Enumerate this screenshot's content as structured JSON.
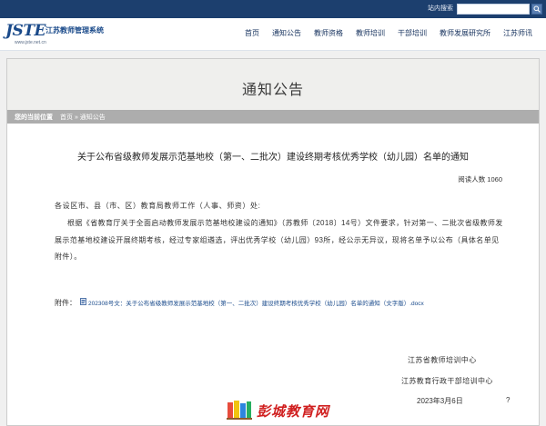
{
  "topbar": {
    "search_label": "站内搜索"
  },
  "logo": {
    "mark_main": "JSTE",
    "mark_accent": "",
    "name": "江苏教师管理系统",
    "url": "www.jste.net.cn"
  },
  "nav": [
    {
      "label": "首页"
    },
    {
      "label": "通知公告"
    },
    {
      "label": "教师资格"
    },
    {
      "label": "教师培训"
    },
    {
      "label": "干部培训"
    },
    {
      "label": "教师发展研究所"
    },
    {
      "label": "江苏师讯"
    }
  ],
  "banner": {
    "title": "通知公告"
  },
  "breadcrumb": {
    "head": "您的当前位置",
    "path": "首页 » 通知公告"
  },
  "article": {
    "title": "关于公布省级教师发展示范基地校（第一、二批次）建设终期考核优秀学校（幼儿园）名单的通知",
    "read_count": "阅读人数 1060",
    "salutation": "各设区市、县（市、区）教育局教师工作（人事、师资）处:",
    "body": "根据《省教育厅关于全面启动教师发展示范基地校建设的通知》（苏教师〔2018〕14号）文件要求，针对第一、二批次省级教师发展示范基地校建设开展终期考核，经过专家组遴选，评出优秀学校（幼儿园）93所，经公示无异议，现将名单予以公布（具体名单见附件）。",
    "attachment_label": "附件：",
    "attachment_link": "202308号文：关于公布省级教师发展示范基地校（第一、二批次）建设终期考核优秀学校（幼儿园）名单的通知（文字版）.docx",
    "signature_1": "江苏省教师培训中心",
    "signature_2": "江苏教育行政干部培训中心",
    "date": "2023年3月6日",
    "date_mark": "?"
  },
  "watermark": {
    "text": "彭城教育网"
  },
  "colors": {
    "topbar": "#1c3f6e",
    "nav_text": "#1a3560",
    "banner_bg": "#efefed",
    "crumb_bg": "#adadad",
    "link": "#1a4b8c",
    "watermark": "#d01f1f"
  }
}
